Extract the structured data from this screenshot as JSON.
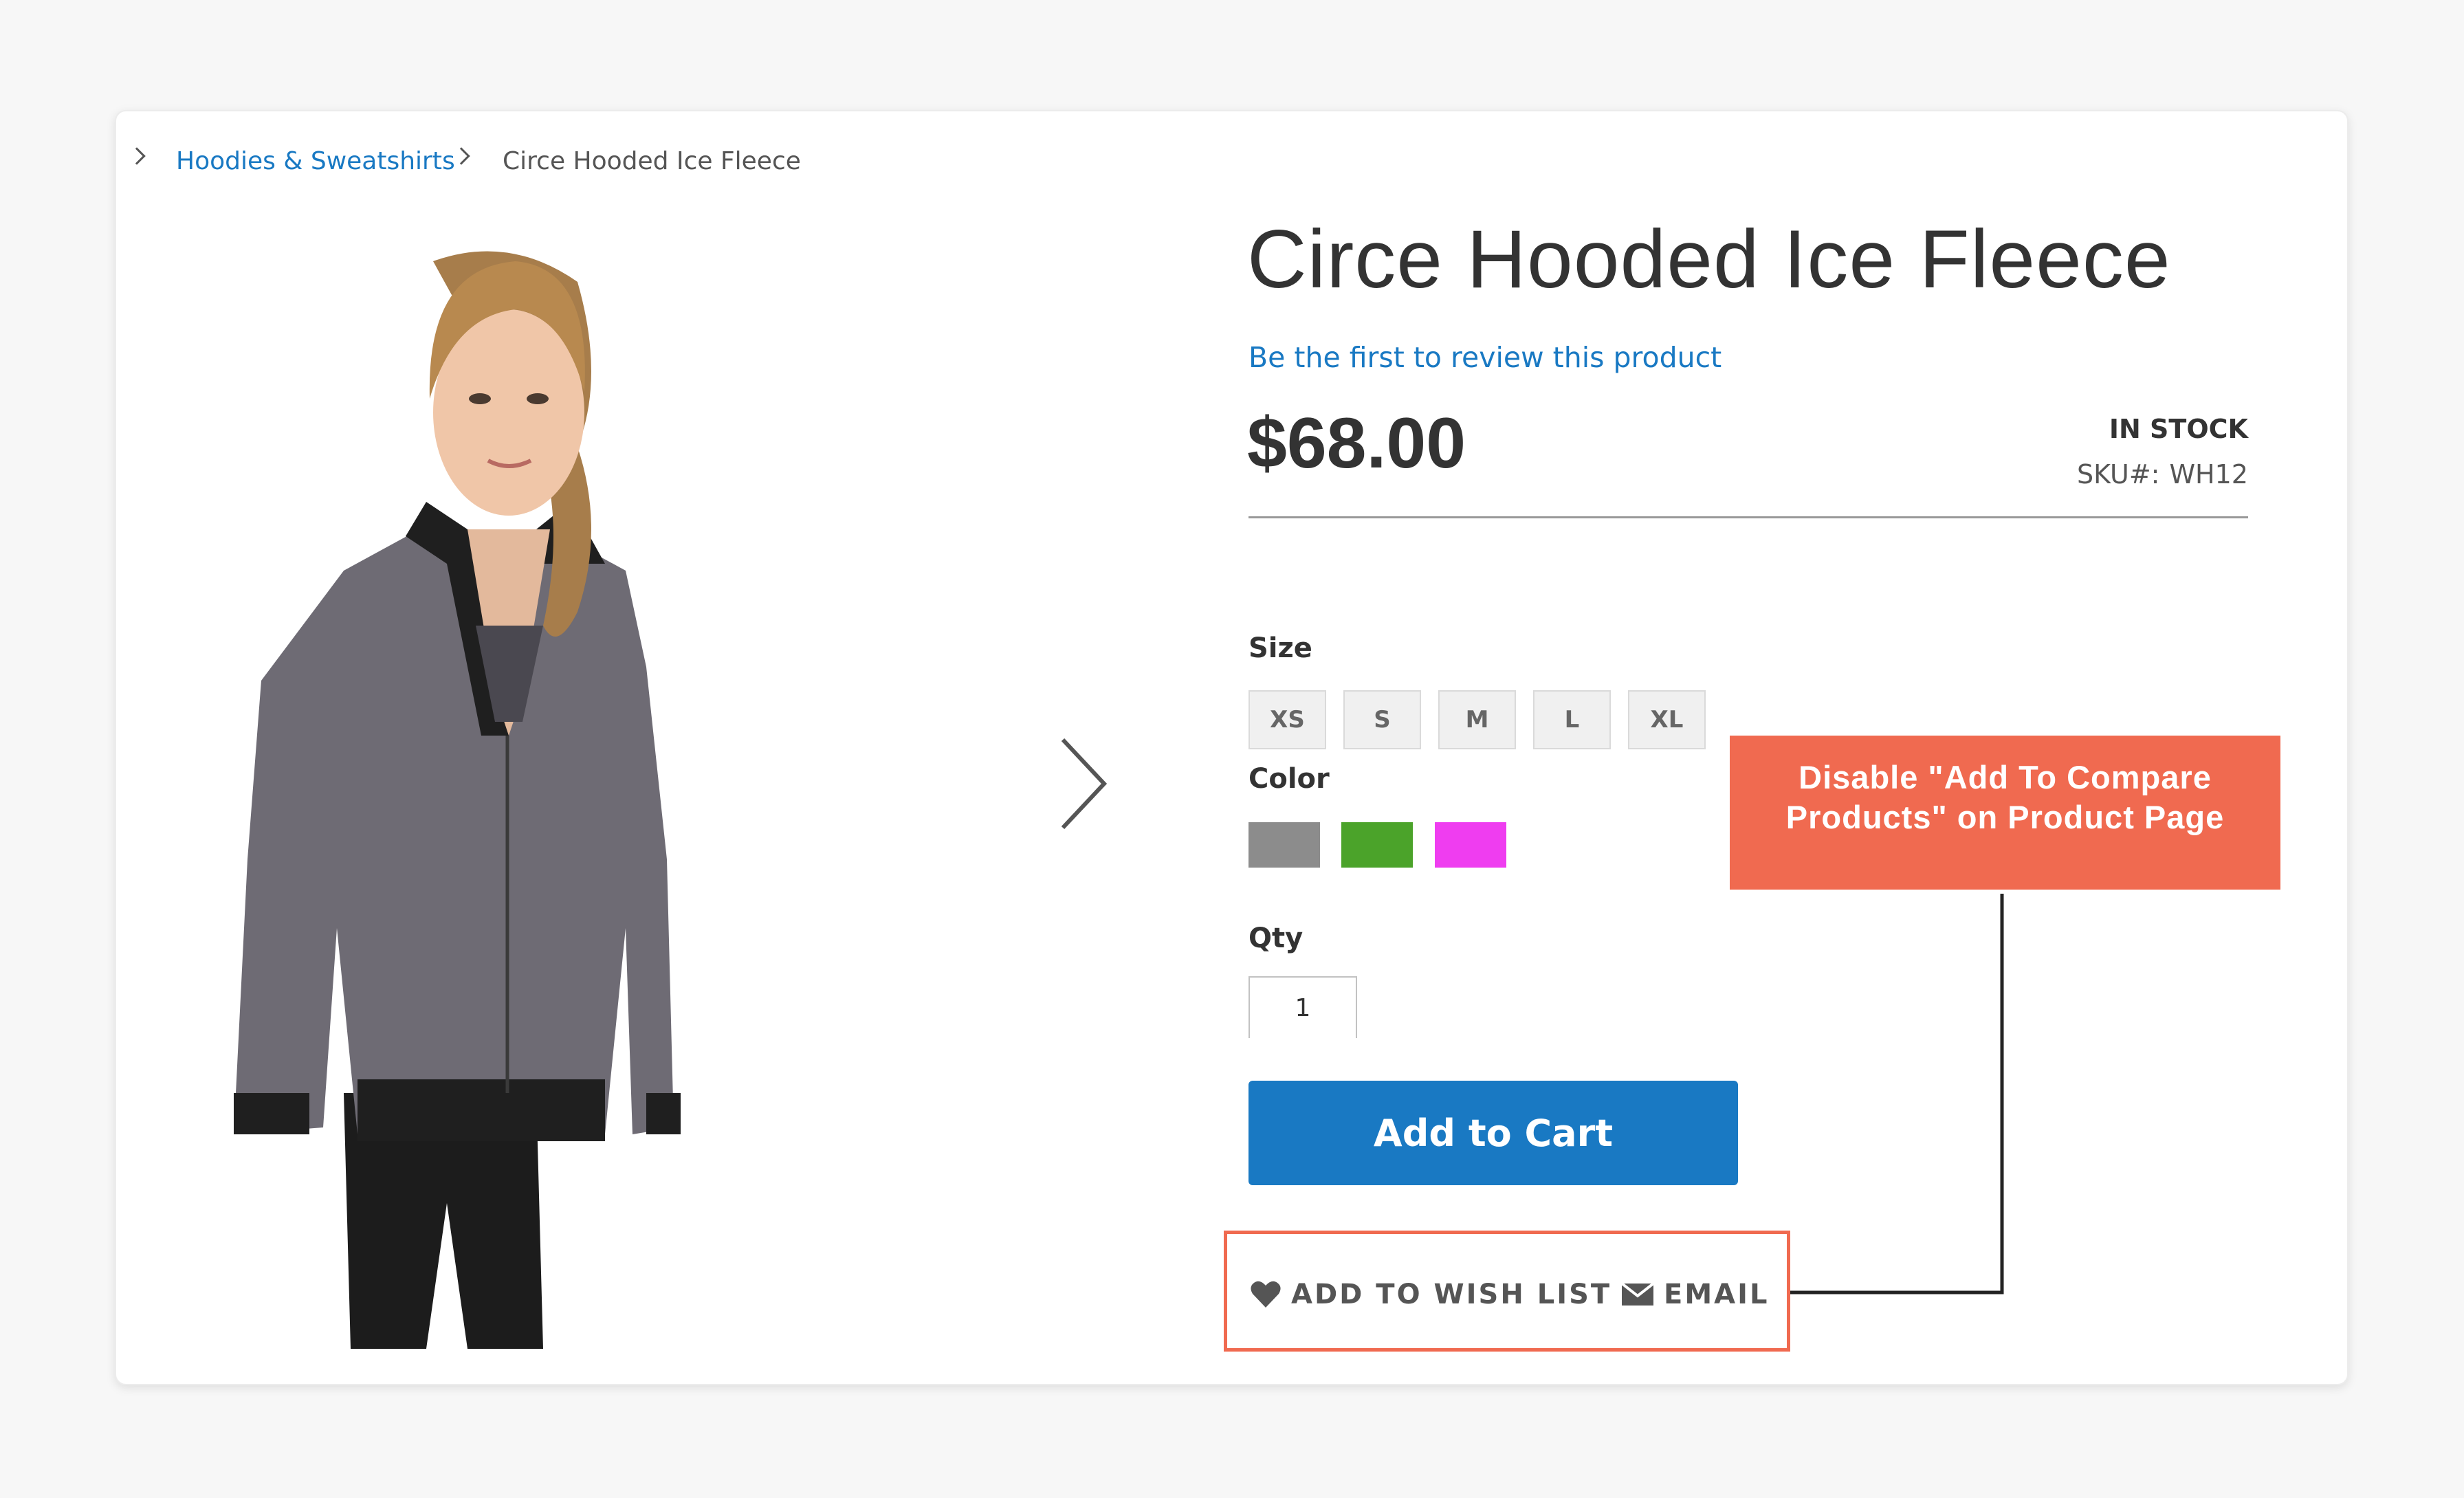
{
  "breadcrumb": {
    "category": "Hoodies & Sweatshirts",
    "current": "Circe Hooded Ice Fleece"
  },
  "product": {
    "title": "Circe Hooded Ice Fleece",
    "review_link": "Be the first to review this product",
    "price": "$68.00",
    "stock": "IN STOCK",
    "sku_label": "SKU#:",
    "sku_value": "WH12"
  },
  "options": {
    "size_label": "Size",
    "sizes": [
      "XS",
      "S",
      "M",
      "L",
      "XL"
    ],
    "color_label": "Color",
    "colors": [
      "#8c8c8c",
      "#4ba32a",
      "#ef3df0"
    ]
  },
  "qty": {
    "label": "Qty",
    "value": "1"
  },
  "add_to_cart_label": "Add to Cart",
  "actions": {
    "wishlist_label": "ADD TO WISH LIST",
    "email_label": "EMAIL"
  },
  "annotation": {
    "line1": "Disable \"Add To Compare",
    "line2": "Products\" on Product Page"
  },
  "colors": {
    "link": "#1979c3",
    "button": "#1979c3",
    "annotation": "#f06a50"
  },
  "icons": [
    "chevron-right-icon",
    "heart-icon",
    "envelope-icon",
    "gallery-next-arrow-icon"
  ]
}
